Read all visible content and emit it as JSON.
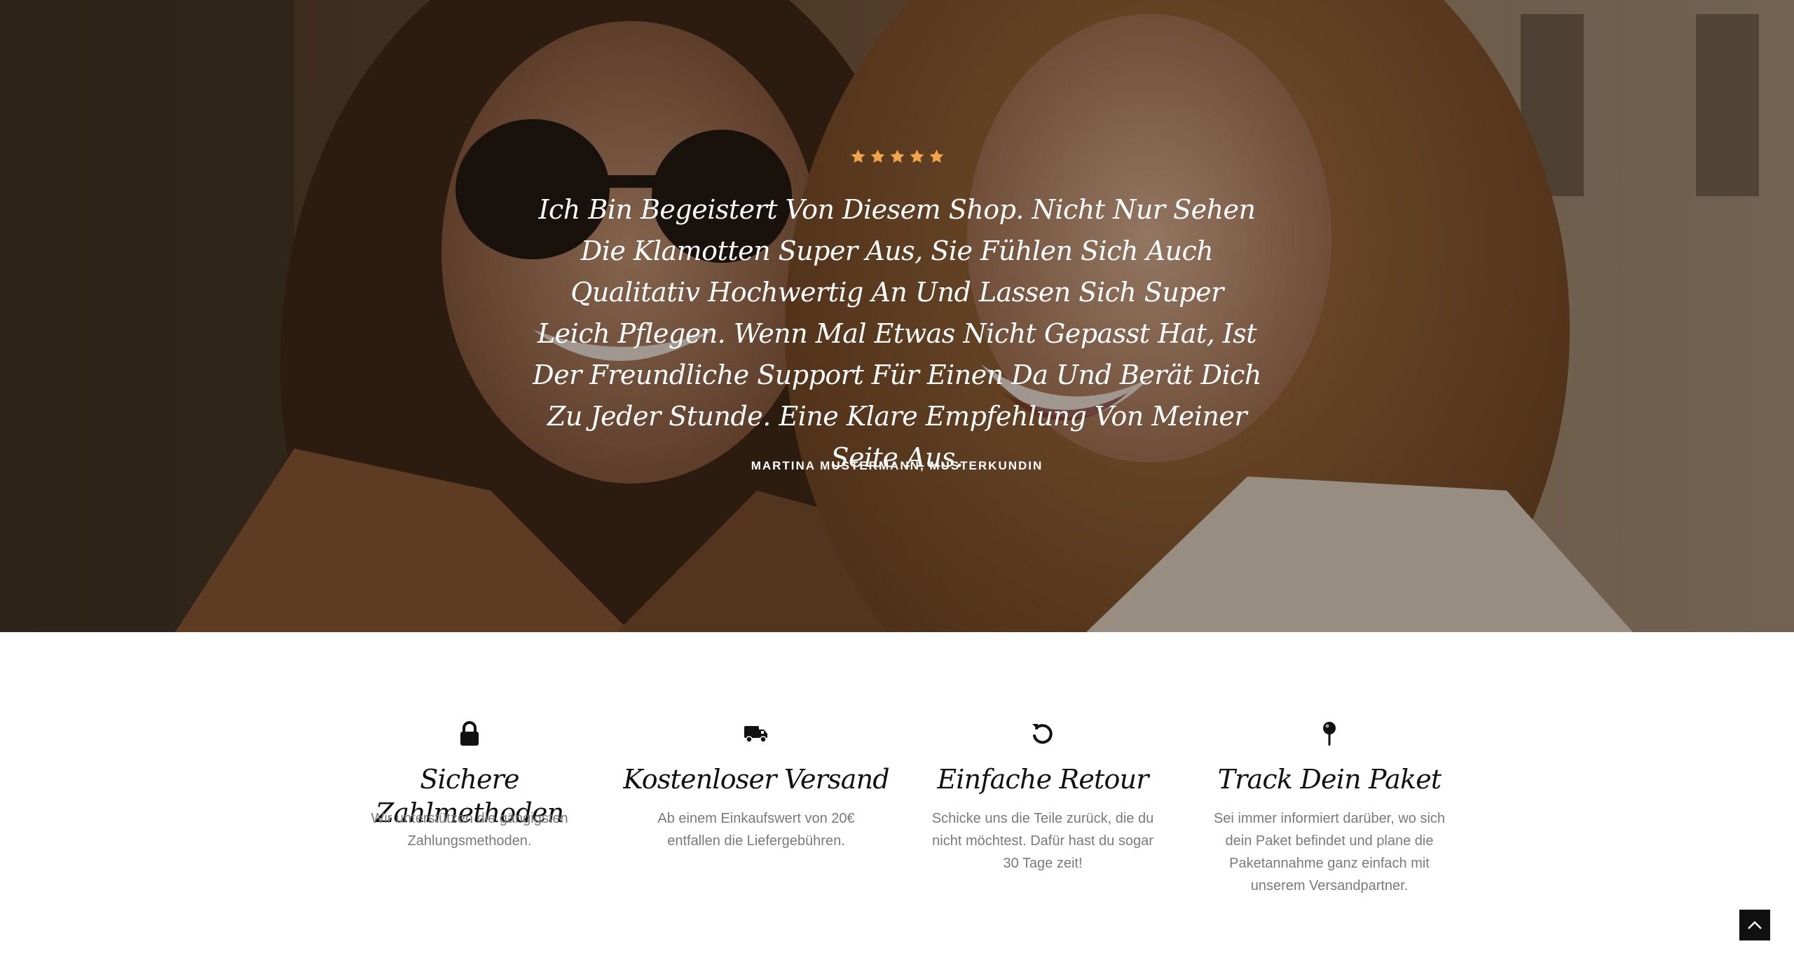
{
  "testimonial": {
    "rating": 5,
    "star_color": "#f0a54a",
    "quote": "Ich Bin Begeistert Von Diesem Shop. Nicht Nur Sehen Die Klamotten Super Aus, Sie Fühlen Sich Auch Qualitativ Hochwertig An Und Lassen Sich Super Leich Pflegen. Wenn Mal Etwas Nicht Gepasst Hat, Ist Der Freundliche Support Für Einen Da Und Berät Dich Zu Jeder Stunde. Eine Klare Empfehlung Von Meiner Seite Aus.",
    "author": "MARTINA MUSTERMANN, MUSTERKUNDIN"
  },
  "features": [
    {
      "icon": "lock-icon",
      "title": "Sichere Zahlmethoden",
      "text": "Wir unterstützen die gängigsten Zahlungsmethoden."
    },
    {
      "icon": "truck-icon",
      "title": "Kostenloser Versand",
      "text": "Ab einem Einkaufswert von 20€ entfallen die Liefergebühren."
    },
    {
      "icon": "undo-icon",
      "title": "Einfache Retour",
      "text": "Schicke uns die Teile zurück, die du nicht möchtest. Dafür hast du sogar 30 Tage zeit!"
    },
    {
      "icon": "map-pin-icon",
      "title": "Track Dein Paket",
      "text": "Sei immer informiert darüber, wo sich dein Paket befindet und plane die Paketannahme ganz einfach mit unserem Versandpartner."
    }
  ],
  "back_to_top": {
    "icon": "chevron-up-icon"
  }
}
